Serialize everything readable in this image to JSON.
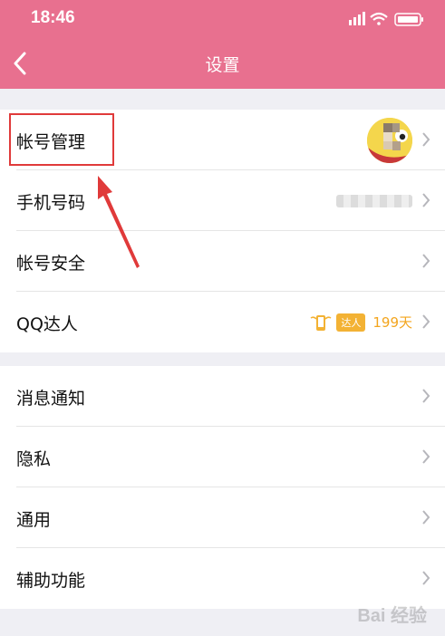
{
  "status_bar": {
    "time": "18:46"
  },
  "nav": {
    "title": "设置"
  },
  "groups": [
    {
      "items": [
        {
          "label": "帐号管理"
        },
        {
          "label": "手机号码"
        },
        {
          "label": "帐号安全"
        },
        {
          "label": "QQ达人",
          "badge_tag": "达人",
          "badge_days": "199天"
        }
      ]
    },
    {
      "items": [
        {
          "label": "消息通知"
        },
        {
          "label": "隐私"
        },
        {
          "label": "通用"
        },
        {
          "label": "辅助功能"
        }
      ]
    }
  ],
  "colors": {
    "header": "#e8708f",
    "background": "#efeff4",
    "annotation": "#e03a3a",
    "talent": "#f3b234"
  },
  "watermark": {
    "text": "Bai 经验"
  },
  "icons": [
    "signal-icon",
    "wifi-icon",
    "battery-icon",
    "back-arrow-icon",
    "chevron-right-icon",
    "avatar",
    "talent-phone-icon"
  ]
}
